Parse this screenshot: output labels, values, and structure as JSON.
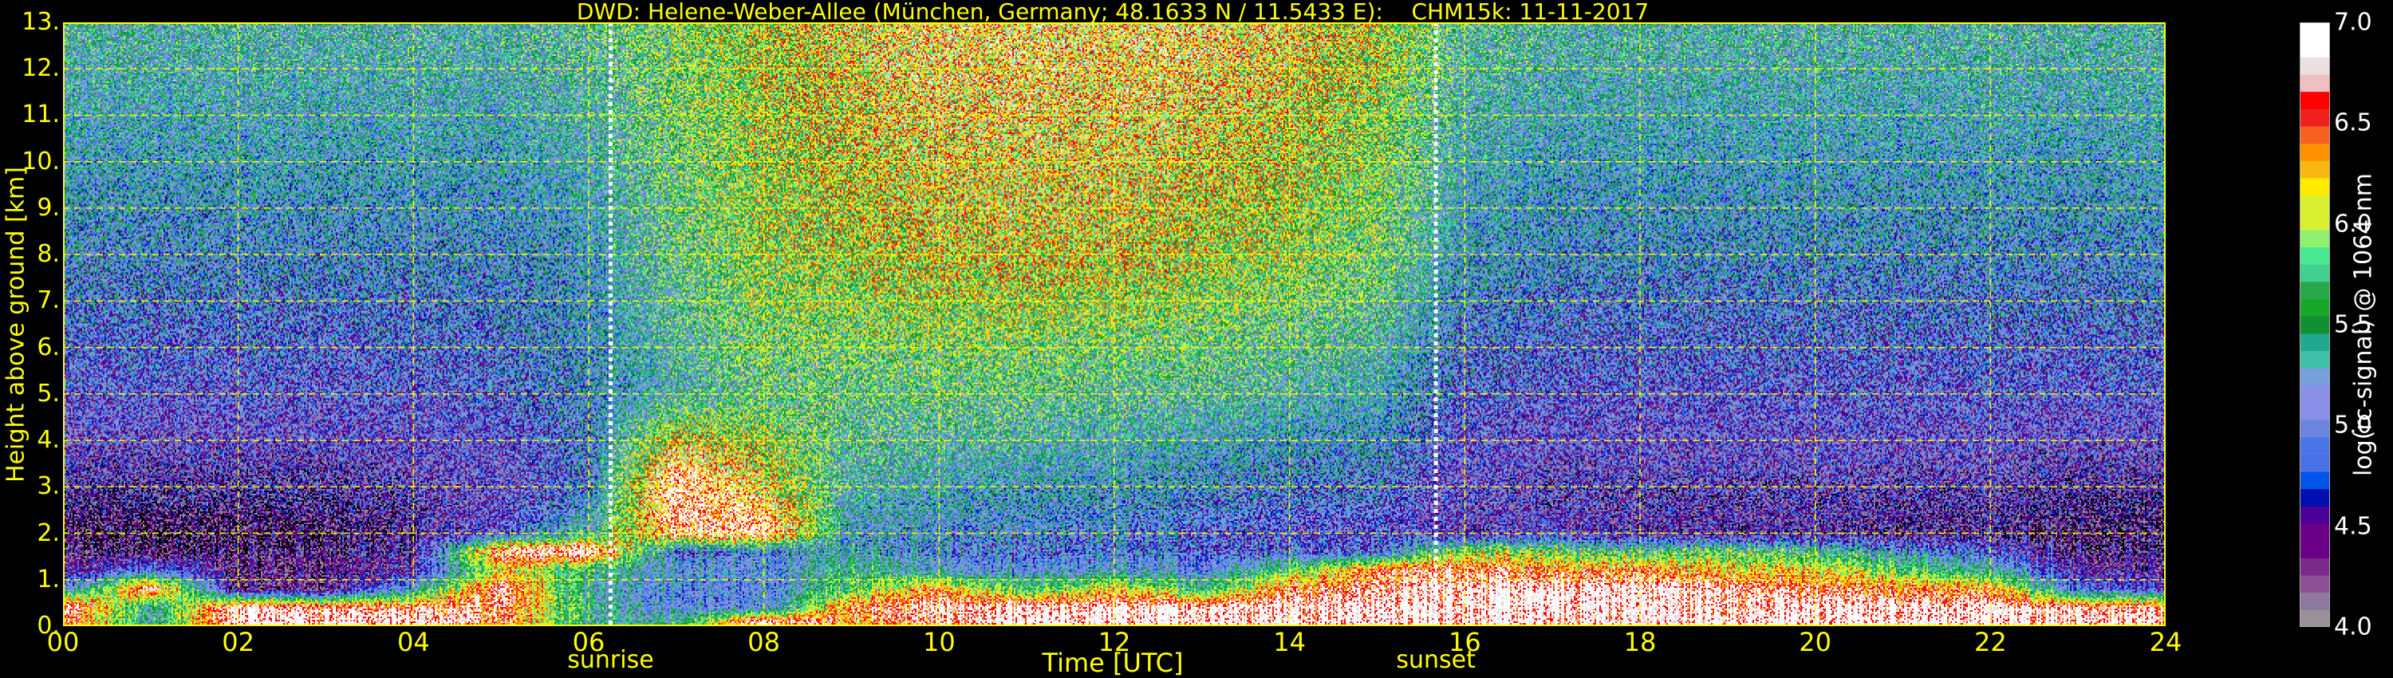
{
  "chart_data": {
    "type": "heatmap",
    "title": "DWD: Helene-Weber-Allee (München, Germany; 48.1633 N / 11.5433 E):    CHM15k: 11-11-2017",
    "xlabel": "Time [UTC]",
    "ylabel": "Height above ground [km]",
    "xlim": [
      0,
      24
    ],
    "ylim": [
      0,
      13
    ],
    "x_tick_labels": [
      "00",
      "02",
      "04",
      "06",
      "08",
      "10",
      "12",
      "14",
      "16",
      "18",
      "20",
      "22",
      "24"
    ],
    "y_tick_labels": [
      "0.",
      "1.",
      "2.",
      "3.",
      "4.",
      "5.",
      "6.",
      "7.",
      "8.",
      "9.",
      "10.",
      "11.",
      "12.",
      "13."
    ],
    "grid": true,
    "grid_color": "#ffff00",
    "annotations": [
      {
        "label": "sunrise",
        "time": 6.25
      },
      {
        "label": "sunset",
        "time": 15.67
      }
    ],
    "colorbar": {
      "label": "log(rc-signal) @ 1064 nm",
      "range": [
        4.0,
        7.0
      ],
      "tick_labels": [
        "4.0",
        "4.5",
        "5.0",
        "5.5",
        "6.0",
        "6.5",
        "7.0"
      ],
      "colors": [
        "#9a9098",
        "#8e7aa0",
        "#8a5295",
        "#7b2a8a",
        "#6a0088",
        "#6a0088",
        "#4b0095",
        "#0010b0",
        "#0055e8",
        "#4a70e8",
        "#4a75e6",
        "#6b85e0",
        "#8a90e8",
        "#8a90e8",
        "#78a0dc",
        "#40c0a8",
        "#20a890",
        "#109030",
        "#18a828",
        "#28a848",
        "#40d090",
        "#48e890",
        "#90f070",
        "#d8f030",
        "#d8f030",
        "#ffec00",
        "#f8b810",
        "#ff9000",
        "#f86020",
        "#f02020",
        "#ff0000",
        "#f0c0c0",
        "#ece0e0",
        "#ffffff",
        "#ffffff"
      ]
    },
    "hours": [
      0,
      1,
      2,
      3,
      4,
      5,
      6,
      7,
      8,
      9,
      10,
      11,
      12,
      13,
      14,
      15,
      16,
      17,
      18,
      19,
      20,
      21,
      22,
      23,
      24
    ],
    "heights_km": [
      0.1,
      0.4,
      0.8,
      1.2,
      1.6,
      2.0,
      3.0,
      5.0,
      8.0,
      12.5
    ],
    "values": [
      [
        6.6,
        5.4,
        6.9,
        6.9,
        6.9,
        6.6,
        5.4,
        5.5,
        6.9,
        6.4,
        6.7,
        6.9,
        6.9,
        6.9,
        6.9,
        6.9,
        6.9,
        6.8,
        6.9,
        6.9,
        6.9,
        6.9,
        6.9,
        6.9,
        6.8
      ],
      [
        6.9,
        5.4,
        6.9,
        6.7,
        6.6,
        6.7,
        5.5,
        5.1,
        5.0,
        6.6,
        6.8,
        6.8,
        6.9,
        6.9,
        6.9,
        6.9,
        6.9,
        6.9,
        6.9,
        6.8,
        6.9,
        6.9,
        6.9,
        6.8,
        6.6
      ],
      [
        5.0,
        6.8,
        4.2,
        4.3,
        5.2,
        6.8,
        5.3,
        5.1,
        5.0,
        5.8,
        6.4,
        5.6,
        6.2,
        5.6,
        6.6,
        6.7,
        6.9,
        6.9,
        6.9,
        6.8,
        6.6,
        6.5,
        6.4,
        5.0,
        4.6
      ],
      [
        4.3,
        5.0,
        4.2,
        4.3,
        4.4,
        6.2,
        5.5,
        5.2,
        5.0,
        5.6,
        5.2,
        5.0,
        5.2,
        5.0,
        5.8,
        6.6,
        6.7,
        6.4,
        6.5,
        6.2,
        6.2,
        5.8,
        5.4,
        4.5,
        4.3
      ],
      [
        4.2,
        4.2,
        4.2,
        4.3,
        4.4,
        6.8,
        6.9,
        5.0,
        5.0,
        5.3,
        5.0,
        4.9,
        5.0,
        4.9,
        4.9,
        4.9,
        6.0,
        5.8,
        5.6,
        5.8,
        5.5,
        5.2,
        4.8,
        4.3,
        4.2
      ],
      [
        4.1,
        4.1,
        4.1,
        4.2,
        4.3,
        4.8,
        5.4,
        6.7,
        6.8,
        5.2,
        5.1,
        5.0,
        5.0,
        4.9,
        4.8,
        4.8,
        4.5,
        4.6,
        4.4,
        4.4,
        4.4,
        4.3,
        4.3,
        4.2,
        4.1
      ],
      [
        4.4,
        4.4,
        4.4,
        4.4,
        4.5,
        4.6,
        5.0,
        6.9,
        6.2,
        5.4,
        5.3,
        5.2,
        5.2,
        5.1,
        5.0,
        5.0,
        4.6,
        4.5,
        4.5,
        4.5,
        4.5,
        4.5,
        4.5,
        4.4,
        4.4
      ],
      [
        4.8,
        4.8,
        4.8,
        4.8,
        4.8,
        4.9,
        5.1,
        5.4,
        5.6,
        5.6,
        5.6,
        5.6,
        5.5,
        5.5,
        5.4,
        5.3,
        4.9,
        4.8,
        4.8,
        4.8,
        4.8,
        4.8,
        4.8,
        4.8,
        4.8
      ],
      [
        5.1,
        5.1,
        5.1,
        5.1,
        5.1,
        5.1,
        5.2,
        5.6,
        5.9,
        6.0,
        6.1,
        6.1,
        6.1,
        6.0,
        5.9,
        5.7,
        5.2,
        5.1,
        5.1,
        5.1,
        5.1,
        5.1,
        5.1,
        5.1,
        5.1
      ],
      [
        5.4,
        5.4,
        5.4,
        5.4,
        5.4,
        5.4,
        5.5,
        5.8,
        6.0,
        6.2,
        6.3,
        6.3,
        6.3,
        6.3,
        6.2,
        6.0,
        5.5,
        5.4,
        5.4,
        5.4,
        5.4,
        5.4,
        5.4,
        5.4,
        5.4
      ]
    ]
  }
}
